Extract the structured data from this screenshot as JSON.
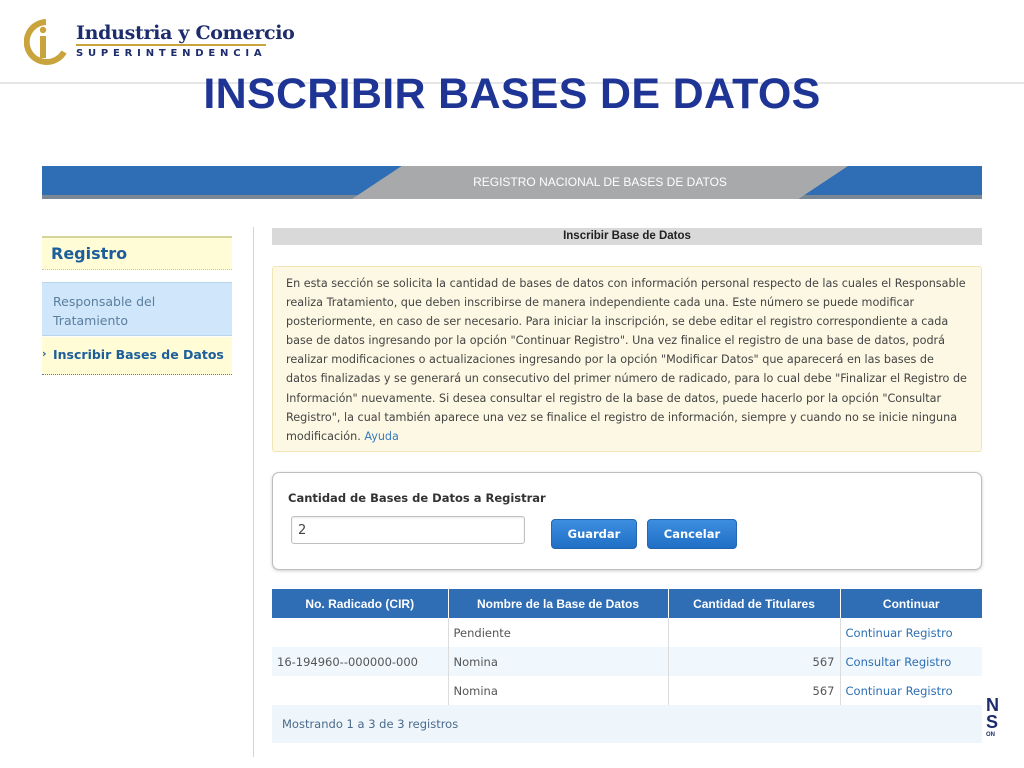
{
  "brand": {
    "line1": "Industria y Comercio",
    "line2": "SUPERINTENDENCIA",
    "colors": {
      "navy": "#1c2c6c",
      "gold": "#c9a43c"
    }
  },
  "slide_title": "INSCRIBIR BASES DE DATOS",
  "banner": {
    "title": "REGISTRO NACIONAL DE BASES DE DATOS"
  },
  "sidebar": {
    "heading": "Registro",
    "items": [
      {
        "label": "Responsable del Tratamiento"
      },
      {
        "label": "Inscribir Bases de Datos",
        "marker": "›"
      }
    ]
  },
  "section": {
    "title": "Inscribir Base de Datos",
    "info_text": "En esta sección se solicita la cantidad de bases de datos con información personal respecto de las cuales el Responsable realiza Tratamiento, que deben inscribirse de manera independiente cada una. Este número se puede modificar posteriormente, en caso de ser necesario. Para iniciar la inscripción, se debe editar el registro correspondiente a cada base de datos ingresando por la opción \"Continuar Registro\". Una vez finalice el registro de una base de datos, podrá realizar modificaciones o actualizaciones ingresando por la opción \"Modificar Datos\" que aparecerá en las bases de datos finalizadas y se generará un consecutivo del primer número de radicado, para lo cual debe \"Finalizar el Registro de Información\" nuevamente. Si desea consultar el registro de la base de datos, puede hacerlo por la opción \"Consultar Registro\", la cual también aparece una vez se finalice el registro de información, siempre y cuando no se inicie ninguna modificación.",
    "help_link": "Ayuda"
  },
  "form": {
    "label": "Cantidad de Bases de Datos a Registrar",
    "value": "2",
    "save_label": "Guardar",
    "cancel_label": "Cancelar"
  },
  "table": {
    "headers": [
      "No. Radicado (CIR)",
      "Nombre de la Base de Datos",
      "Cantidad de Titulares",
      "Continuar"
    ],
    "rows": [
      {
        "radicado": "",
        "nombre": "Pendiente",
        "titulares": "",
        "accion": "Continuar Registro"
      },
      {
        "radicado": "16-194960--000000-000",
        "nombre": "Nomina",
        "titulares": "567",
        "accion": "Consultar Registro"
      },
      {
        "radicado": "",
        "nombre": "Nomina",
        "titulares": "567",
        "accion": "Continuar Registro"
      }
    ],
    "footer": "Mostrando 1 a 3 de 3 registros"
  },
  "edge_text": {
    "line1": "N",
    "line2": "S",
    "line3": "ON"
  },
  "colors": {
    "title_blue": "#1f3595",
    "banner_blue": "#2f6db4",
    "button_blue": "#1f6fc5",
    "info_bg": "#fcf8e3"
  }
}
